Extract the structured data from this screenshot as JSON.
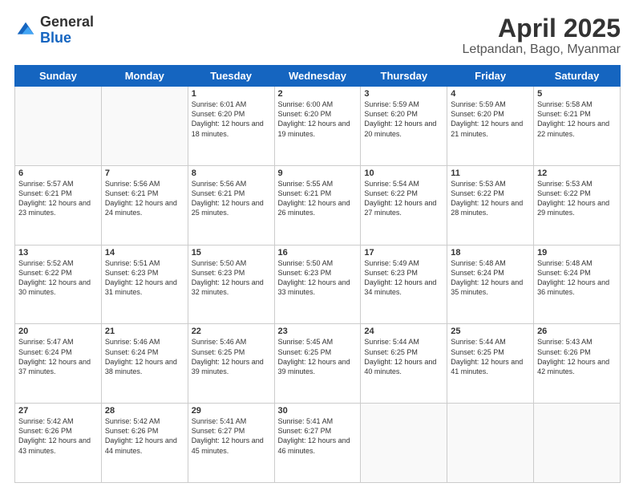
{
  "header": {
    "logo_general": "General",
    "logo_blue": "Blue",
    "title": "April 2025",
    "location": "Letpandan, Bago, Myanmar"
  },
  "weekdays": [
    "Sunday",
    "Monday",
    "Tuesday",
    "Wednesday",
    "Thursday",
    "Friday",
    "Saturday"
  ],
  "weeks": [
    [
      {
        "day": "",
        "sunrise": "",
        "sunset": "",
        "daylight": ""
      },
      {
        "day": "",
        "sunrise": "",
        "sunset": "",
        "daylight": ""
      },
      {
        "day": "1",
        "sunrise": "Sunrise: 6:01 AM",
        "sunset": "Sunset: 6:20 PM",
        "daylight": "Daylight: 12 hours and 18 minutes."
      },
      {
        "day": "2",
        "sunrise": "Sunrise: 6:00 AM",
        "sunset": "Sunset: 6:20 PM",
        "daylight": "Daylight: 12 hours and 19 minutes."
      },
      {
        "day": "3",
        "sunrise": "Sunrise: 5:59 AM",
        "sunset": "Sunset: 6:20 PM",
        "daylight": "Daylight: 12 hours and 20 minutes."
      },
      {
        "day": "4",
        "sunrise": "Sunrise: 5:59 AM",
        "sunset": "Sunset: 6:20 PM",
        "daylight": "Daylight: 12 hours and 21 minutes."
      },
      {
        "day": "5",
        "sunrise": "Sunrise: 5:58 AM",
        "sunset": "Sunset: 6:21 PM",
        "daylight": "Daylight: 12 hours and 22 minutes."
      }
    ],
    [
      {
        "day": "6",
        "sunrise": "Sunrise: 5:57 AM",
        "sunset": "Sunset: 6:21 PM",
        "daylight": "Daylight: 12 hours and 23 minutes."
      },
      {
        "day": "7",
        "sunrise": "Sunrise: 5:56 AM",
        "sunset": "Sunset: 6:21 PM",
        "daylight": "Daylight: 12 hours and 24 minutes."
      },
      {
        "day": "8",
        "sunrise": "Sunrise: 5:56 AM",
        "sunset": "Sunset: 6:21 PM",
        "daylight": "Daylight: 12 hours and 25 minutes."
      },
      {
        "day": "9",
        "sunrise": "Sunrise: 5:55 AM",
        "sunset": "Sunset: 6:21 PM",
        "daylight": "Daylight: 12 hours and 26 minutes."
      },
      {
        "day": "10",
        "sunrise": "Sunrise: 5:54 AM",
        "sunset": "Sunset: 6:22 PM",
        "daylight": "Daylight: 12 hours and 27 minutes."
      },
      {
        "day": "11",
        "sunrise": "Sunrise: 5:53 AM",
        "sunset": "Sunset: 6:22 PM",
        "daylight": "Daylight: 12 hours and 28 minutes."
      },
      {
        "day": "12",
        "sunrise": "Sunrise: 5:53 AM",
        "sunset": "Sunset: 6:22 PM",
        "daylight": "Daylight: 12 hours and 29 minutes."
      }
    ],
    [
      {
        "day": "13",
        "sunrise": "Sunrise: 5:52 AM",
        "sunset": "Sunset: 6:22 PM",
        "daylight": "Daylight: 12 hours and 30 minutes."
      },
      {
        "day": "14",
        "sunrise": "Sunrise: 5:51 AM",
        "sunset": "Sunset: 6:23 PM",
        "daylight": "Daylight: 12 hours and 31 minutes."
      },
      {
        "day": "15",
        "sunrise": "Sunrise: 5:50 AM",
        "sunset": "Sunset: 6:23 PM",
        "daylight": "Daylight: 12 hours and 32 minutes."
      },
      {
        "day": "16",
        "sunrise": "Sunrise: 5:50 AM",
        "sunset": "Sunset: 6:23 PM",
        "daylight": "Daylight: 12 hours and 33 minutes."
      },
      {
        "day": "17",
        "sunrise": "Sunrise: 5:49 AM",
        "sunset": "Sunset: 6:23 PM",
        "daylight": "Daylight: 12 hours and 34 minutes."
      },
      {
        "day": "18",
        "sunrise": "Sunrise: 5:48 AM",
        "sunset": "Sunset: 6:24 PM",
        "daylight": "Daylight: 12 hours and 35 minutes."
      },
      {
        "day": "19",
        "sunrise": "Sunrise: 5:48 AM",
        "sunset": "Sunset: 6:24 PM",
        "daylight": "Daylight: 12 hours and 36 minutes."
      }
    ],
    [
      {
        "day": "20",
        "sunrise": "Sunrise: 5:47 AM",
        "sunset": "Sunset: 6:24 PM",
        "daylight": "Daylight: 12 hours and 37 minutes."
      },
      {
        "day": "21",
        "sunrise": "Sunrise: 5:46 AM",
        "sunset": "Sunset: 6:24 PM",
        "daylight": "Daylight: 12 hours and 38 minutes."
      },
      {
        "day": "22",
        "sunrise": "Sunrise: 5:46 AM",
        "sunset": "Sunset: 6:25 PM",
        "daylight": "Daylight: 12 hours and 39 minutes."
      },
      {
        "day": "23",
        "sunrise": "Sunrise: 5:45 AM",
        "sunset": "Sunset: 6:25 PM",
        "daylight": "Daylight: 12 hours and 39 minutes."
      },
      {
        "day": "24",
        "sunrise": "Sunrise: 5:44 AM",
        "sunset": "Sunset: 6:25 PM",
        "daylight": "Daylight: 12 hours and 40 minutes."
      },
      {
        "day": "25",
        "sunrise": "Sunrise: 5:44 AM",
        "sunset": "Sunset: 6:25 PM",
        "daylight": "Daylight: 12 hours and 41 minutes."
      },
      {
        "day": "26",
        "sunrise": "Sunrise: 5:43 AM",
        "sunset": "Sunset: 6:26 PM",
        "daylight": "Daylight: 12 hours and 42 minutes."
      }
    ],
    [
      {
        "day": "27",
        "sunrise": "Sunrise: 5:42 AM",
        "sunset": "Sunset: 6:26 PM",
        "daylight": "Daylight: 12 hours and 43 minutes."
      },
      {
        "day": "28",
        "sunrise": "Sunrise: 5:42 AM",
        "sunset": "Sunset: 6:26 PM",
        "daylight": "Daylight: 12 hours and 44 minutes."
      },
      {
        "day": "29",
        "sunrise": "Sunrise: 5:41 AM",
        "sunset": "Sunset: 6:27 PM",
        "daylight": "Daylight: 12 hours and 45 minutes."
      },
      {
        "day": "30",
        "sunrise": "Sunrise: 5:41 AM",
        "sunset": "Sunset: 6:27 PM",
        "daylight": "Daylight: 12 hours and 46 minutes."
      },
      {
        "day": "",
        "sunrise": "",
        "sunset": "",
        "daylight": ""
      },
      {
        "day": "",
        "sunrise": "",
        "sunset": "",
        "daylight": ""
      },
      {
        "day": "",
        "sunrise": "",
        "sunset": "",
        "daylight": ""
      }
    ]
  ]
}
